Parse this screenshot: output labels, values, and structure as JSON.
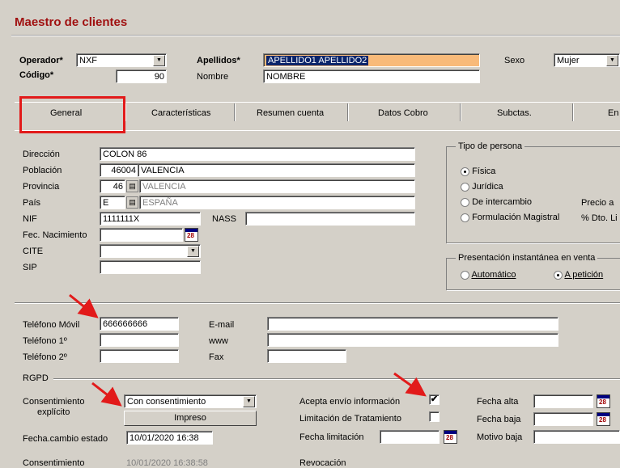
{
  "title": "Maestro de clientes",
  "header": {
    "operador_label": "Operador*",
    "operador_value": "NXF",
    "codigo_label": "Código*",
    "codigo_value": "90",
    "apellidos_label": "Apellidos*",
    "apellidos_value": "APELLIDO1 APELLIDO2",
    "nombre_label": "Nombre",
    "nombre_value": "NOMBRE",
    "sexo_label": "Sexo",
    "sexo_value": "Mujer"
  },
  "tabs": [
    "General",
    "Características",
    "Resumen cuenta",
    "Datos Cobro",
    "Subctas.",
    "En"
  ],
  "address": {
    "direccion_label": "Dirección",
    "direccion_value": "COLON 86",
    "poblacion_label": "Población",
    "poblacion_cp": "46004",
    "poblacion_value": "VALENCIA",
    "provincia_label": "Provincia",
    "provincia_code": "46",
    "provincia_value": "VALENCIA",
    "pais_label": "País",
    "pais_code": "E",
    "pais_value": "ESPAÑA",
    "nif_label": "NIF",
    "nif_value": "1111111X",
    "nass_label": "NASS",
    "nass_value": "",
    "fec_nac_label": "Fec. Nacimiento",
    "fec_nac_value": "",
    "cite_label": "CITE",
    "cite_value": "",
    "sip_label": "SIP",
    "sip_value": ""
  },
  "tipo_persona": {
    "title": "Tipo de persona",
    "options": [
      "Física",
      "Jurídica",
      "De intercambio",
      "Formulación Magistral"
    ],
    "selected": "Física",
    "precio_label": "Precio a",
    "dto_label": "% Dto. Li"
  },
  "presentacion": {
    "title": "Presentación instantánea en venta",
    "options": [
      "Automático",
      "A petición"
    ],
    "selected": "A petición"
  },
  "contact": {
    "movil_label": "Teléfono Móvil",
    "movil_value": "666666666",
    "tel1_label": "Teléfono 1º",
    "tel1_value": "",
    "tel2_label": "Teléfono 2º",
    "tel2_value": "",
    "email_label": "E-mail",
    "email_value": "",
    "www_label": "www",
    "www_value": "",
    "fax_label": "Fax",
    "fax_value": ""
  },
  "rgpd": {
    "title": "RGPD",
    "consent_label_1": "Consentimiento",
    "consent_label_2": "explícito",
    "consent_value": "Con consentimiento",
    "impreso_label": "Impreso",
    "fecha_cambio_label": "Fecha.cambio estado",
    "fecha_cambio_value": "10/01/2020 16:38",
    "consentimiento_label": "Consentimiento",
    "consentimiento_value": "10/01/2020 16:38:58",
    "acepta_label": "Acepta envío información",
    "acepta_checked": "✔",
    "limitacion_label": "Limitación de Tratamiento",
    "limitacion_checked": "",
    "fecha_limitacion_label": "Fecha limitación",
    "fecha_limitacion_value": "",
    "revocacion_label": "Revocación",
    "fecha_alta_label": "Fecha alta",
    "fecha_alta_value": "",
    "fecha_baja_label": "Fecha baja",
    "fecha_baja_value": "",
    "motivo_baja_label": "Motivo baja",
    "motivo_baja_value": ""
  },
  "colors": {
    "window_bg": "#d4d0c8",
    "title": "#a01010",
    "annotation_red": "#e21a1a",
    "selection": "#0a246a"
  }
}
